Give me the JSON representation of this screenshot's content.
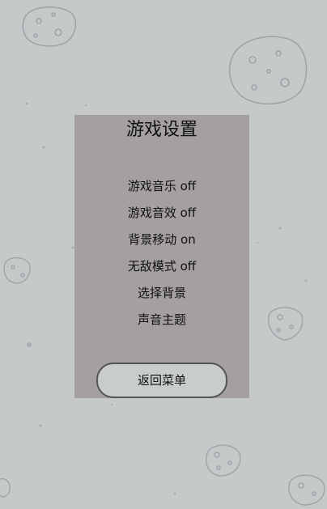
{
  "settings": {
    "title": "游戏设置",
    "options": [
      {
        "label": "游戏音乐 off"
      },
      {
        "label": "游戏音效 off"
      },
      {
        "label": "背景移动 on"
      },
      {
        "label": "无敌模式 off"
      },
      {
        "label": "选择背景"
      },
      {
        "label": "声音主题"
      }
    ],
    "back_label": "返回菜单"
  },
  "colors": {
    "background": "#c6c9ca",
    "panel": "#a3a09f",
    "button": "#c8cccd"
  }
}
